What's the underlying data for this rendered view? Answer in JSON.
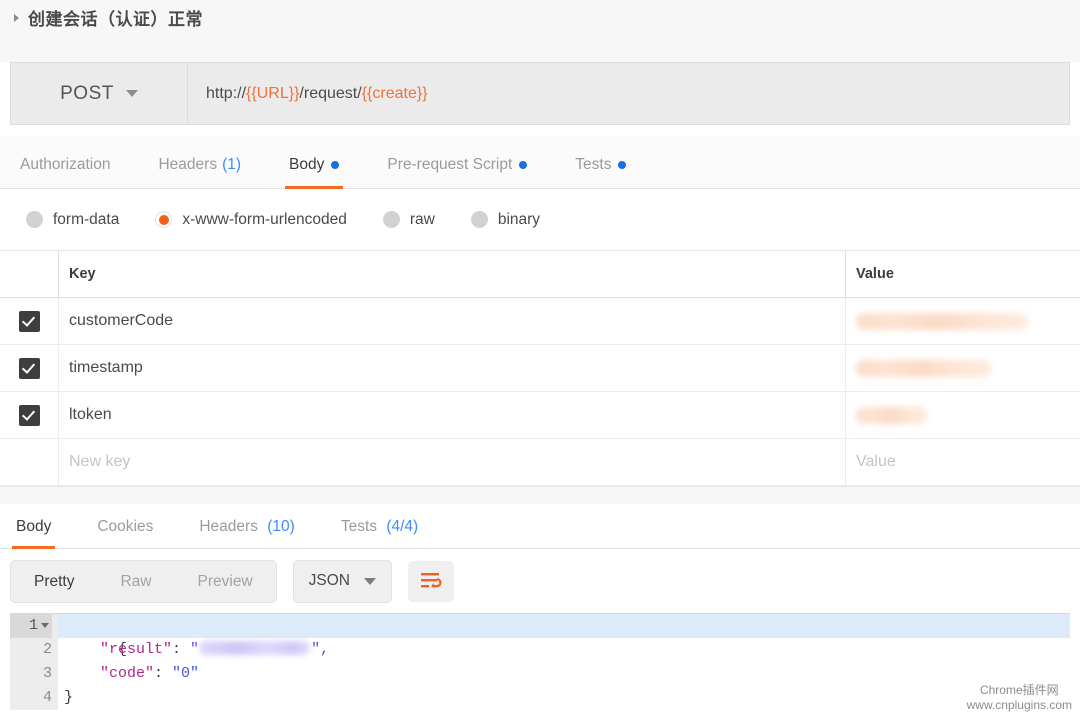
{
  "request": {
    "title": "创建会话（认证）正常",
    "method": "POST",
    "url_parts": [
      {
        "text": "http://",
        "kind": "plain"
      },
      {
        "text": "{{URL}}",
        "kind": "var"
      },
      {
        "text": "/request/",
        "kind": "plain"
      },
      {
        "text": "{{create}}",
        "kind": "var"
      }
    ],
    "tabs": [
      {
        "label": "Authorization",
        "count": "",
        "dot": false,
        "active": false
      },
      {
        "label": "Headers",
        "count": "(1)",
        "dot": false,
        "active": false
      },
      {
        "label": "Body",
        "count": "",
        "dot": true,
        "active": true
      },
      {
        "label": "Pre-request Script",
        "count": "",
        "dot": true,
        "active": false
      },
      {
        "label": "Tests",
        "count": "",
        "dot": true,
        "active": false
      }
    ],
    "body_types": [
      {
        "label": "form-data",
        "selected": false
      },
      {
        "label": "x-www-form-urlencoded",
        "selected": true
      },
      {
        "label": "raw",
        "selected": false
      },
      {
        "label": "binary",
        "selected": false
      }
    ],
    "table": {
      "headers": {
        "key": "Key",
        "value": "Value"
      },
      "rows": [
        {
          "checked": true,
          "key": "customerCode",
          "value_redacted": true,
          "redact_width": "w1"
        },
        {
          "checked": true,
          "key": "timestamp",
          "value_redacted": true,
          "redact_width": "w2"
        },
        {
          "checked": true,
          "key": "ltoken",
          "value_redacted": true,
          "redact_width": "w3"
        }
      ],
      "new_row": {
        "key_placeholder": "New key",
        "value_placeholder": "Value"
      }
    }
  },
  "response": {
    "tabs": [
      {
        "label": "Body",
        "count": "",
        "active": true
      },
      {
        "label": "Cookies",
        "count": "",
        "active": false
      },
      {
        "label": "Headers",
        "count": "(10)",
        "active": false
      },
      {
        "label": "Tests",
        "count": "(4/4)",
        "active": false
      }
    ],
    "view_modes": [
      {
        "label": "Pretty",
        "active": true
      },
      {
        "label": "Raw",
        "active": false
      },
      {
        "label": "Preview",
        "active": false
      }
    ],
    "format_select": "JSON",
    "wrap_icon": "word-wrap-icon",
    "code": {
      "line_numbers": [
        "1",
        "2",
        "3",
        "4"
      ],
      "line1": "{",
      "line2_key": "\"result\"",
      "line2_colon": ": ",
      "line2_value_redacted": true,
      "line2_tail": "\",",
      "line2_quote": "\"",
      "line3_key": "\"code\"",
      "line3_colon": ": ",
      "line3_value": "\"0\"",
      "line4": "}"
    }
  },
  "watermark": {
    "line1": "Chrome插件网",
    "line2": "www.cnplugins.com"
  },
  "colors": {
    "accent_orange": "#f26b21",
    "link_blue": "#3d8bfd",
    "dot_blue": "#1a6fe0",
    "var_orange": "#f0713a"
  }
}
